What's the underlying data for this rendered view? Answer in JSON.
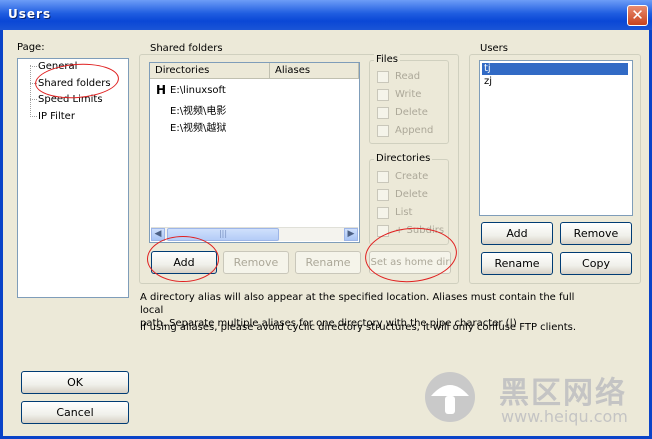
{
  "window": {
    "title": "Users",
    "close_glyph": "✕"
  },
  "page_panel": {
    "label": "Page:",
    "items": [
      "General",
      "Shared folders",
      "Speed Limits",
      "IP Filter"
    ]
  },
  "shared_folders": {
    "group_label": "Shared folders",
    "columns": [
      "Directories",
      "Aliases"
    ],
    "rows": [
      {
        "marker": "H",
        "path": "E:\\linuxsoft",
        "alias": ""
      },
      {
        "marker": "",
        "path": "E:\\视频\\电影",
        "alias": ""
      },
      {
        "marker": "",
        "path": "E:\\视频\\越狱",
        "alias": ""
      }
    ],
    "buttons": {
      "add": "Add",
      "remove": "Remove",
      "rename": "Rename",
      "set_home": "Set as home dir"
    }
  },
  "files_group": {
    "label": "Files",
    "options": [
      "Read",
      "Write",
      "Delete",
      "Append"
    ]
  },
  "directories_group": {
    "label": "Directories",
    "options": [
      "Create",
      "Delete",
      "List",
      "+ Subdirs"
    ]
  },
  "users_panel": {
    "label": "Users",
    "items": [
      "tj",
      "zj"
    ],
    "selected_index": 0,
    "buttons": {
      "add": "Add",
      "remove": "Remove",
      "rename": "Rename",
      "copy": "Copy"
    }
  },
  "info_text": {
    "line1": "A directory alias will also appear at the specified location. Aliases must contain the full local",
    "line2": "path. Separate multiple aliases for one directory with the pipe character (|)",
    "line3": "If using aliases, please avoid cyclic directory structures, it will only confuse FTP clients."
  },
  "dialog_buttons": {
    "ok": "OK",
    "cancel": "Cancel"
  },
  "watermark": {
    "title": "黑区网络",
    "url": "www.heiqu.com"
  },
  "colors": {
    "title_bar": "#0a47d6",
    "selection": "#316ac5",
    "annotation": "#e02020",
    "face": "#ece9d8"
  }
}
